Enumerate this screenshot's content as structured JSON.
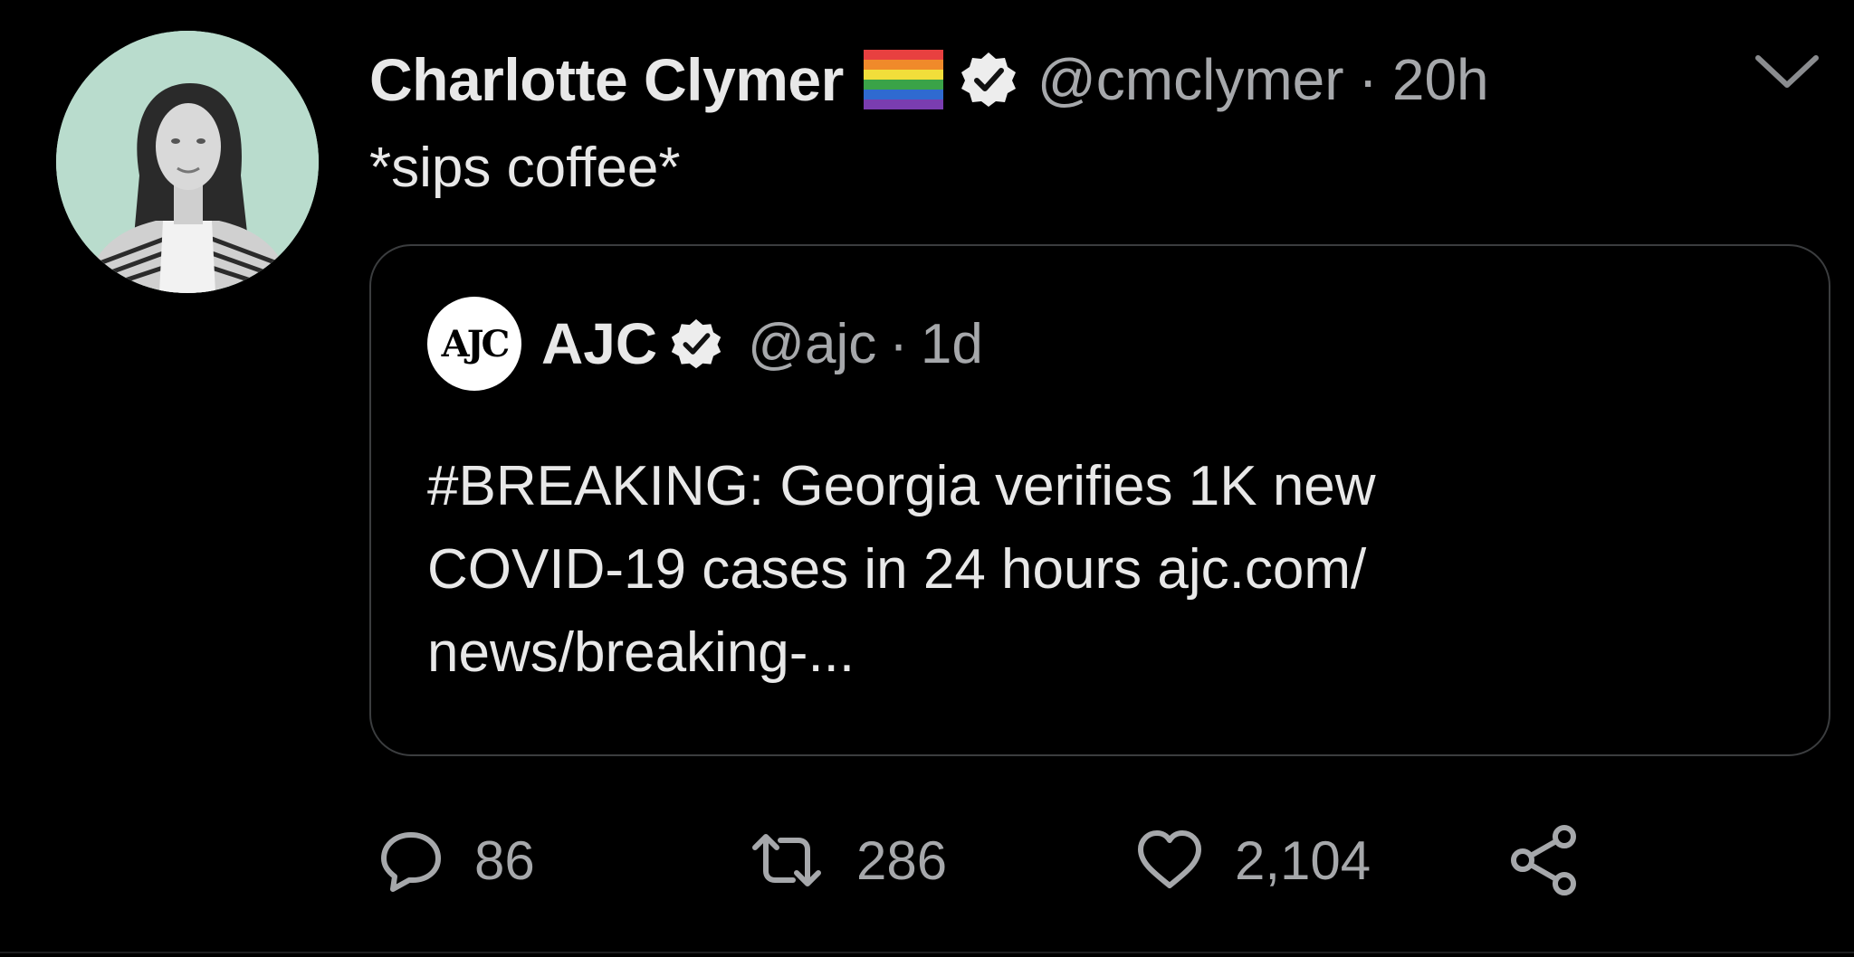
{
  "tweet": {
    "display_name": "Charlotte Clymer",
    "handle": "@cmclymer",
    "separator": "·",
    "time": "20h",
    "text": "*sips coffee*"
  },
  "quoted": {
    "avatar_text": "AJC",
    "display_name": "AJC",
    "handle": "@ajc",
    "separator": "·",
    "time": "1d",
    "lines": [
      "#BREAKING: Georgia verifies 1K new",
      "COVID-19 cases in 24 hours ajc.com/",
      "news/breaking-..."
    ]
  },
  "actions": {
    "replies": "86",
    "retweets": "286",
    "likes": "2,104"
  },
  "colors": {
    "background": "#000000",
    "text_primary": "#e8e8e8",
    "text_secondary": "#a6a8ab",
    "border": "#3b3d3f",
    "avatar_bg": "#b9dccd"
  },
  "icons": {
    "flag": "rainbow-flag-icon",
    "verified": "verified-badge-icon",
    "caret": "chevron-down-icon",
    "reply": "reply-icon",
    "retweet": "retweet-icon",
    "like": "heart-icon",
    "share": "share-icon"
  }
}
